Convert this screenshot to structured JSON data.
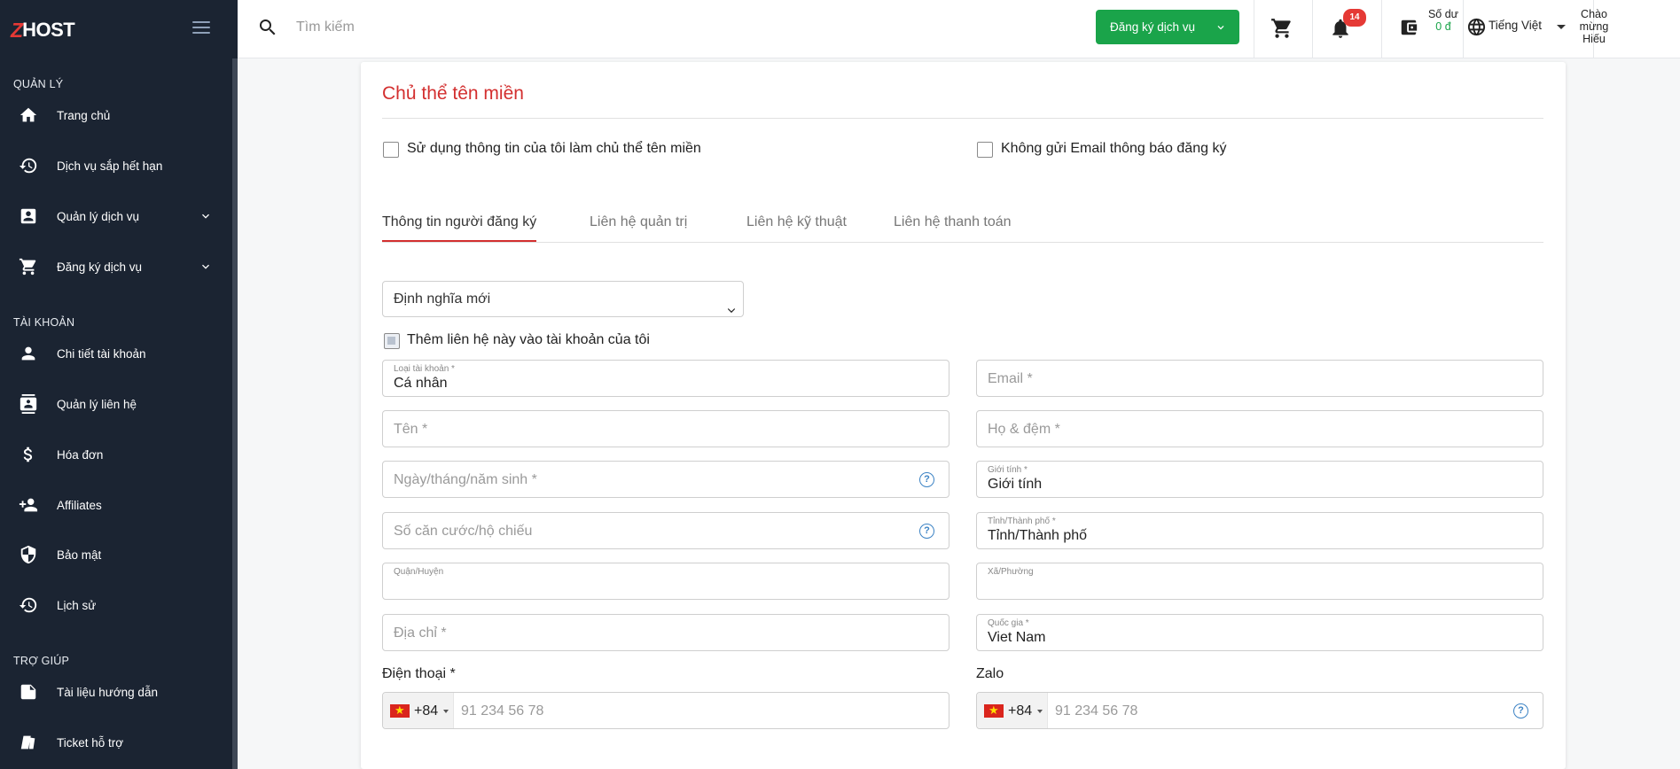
{
  "brand": {
    "logo_z": "Z",
    "logo_text": "HOST"
  },
  "sidebar": {
    "sections": [
      {
        "title": "QUẢN LÝ"
      },
      {
        "title": "TÀI KHOẢN"
      },
      {
        "title": "TRỢ GIÚP"
      }
    ],
    "items": [
      {
        "label": "Trang chủ",
        "icon": "home-icon"
      },
      {
        "label": "Dịch vụ sắp hết hạn",
        "icon": "history-icon"
      },
      {
        "label": "Quản lý dịch vụ",
        "icon": "account-box-icon",
        "expandable": true
      },
      {
        "label": "Đăng ký dịch vụ",
        "icon": "cart-icon",
        "expandable": true
      },
      {
        "label": "Chi tiết tài khoản",
        "icon": "person-icon"
      },
      {
        "label": "Quản lý liên hệ",
        "icon": "contacts-icon"
      },
      {
        "label": "Hóa đơn",
        "icon": "dollar-icon"
      },
      {
        "label": "Affiliates",
        "icon": "person-add-icon"
      },
      {
        "label": "Bảo mật",
        "icon": "shield-icon"
      },
      {
        "label": "Lịch sử",
        "icon": "history-icon"
      },
      {
        "label": "Tài liệu hướng dẫn",
        "icon": "document-icon"
      },
      {
        "label": "Ticket hỗ trợ",
        "icon": "ticket-icon"
      }
    ]
  },
  "topbar": {
    "search_placeholder": "Tìm kiếm",
    "register_button": "Đăng ký dịch vụ",
    "notification_count": "14",
    "balance_label": "Số dư",
    "balance_amount": "0 đ",
    "language": "Tiếng Việt",
    "welcome": "Chào mừng Hiếu"
  },
  "card": {
    "title": "Chủ thể tên miền",
    "use_my_info": "Sử dụng thông tin của tôi làm chủ thể tên miền",
    "no_email": "Không gửi Email thông báo đăng ký",
    "tabs": [
      {
        "label": "Thông tin người đăng ký",
        "active": true
      },
      {
        "label": "Liên hệ quản trị"
      },
      {
        "label": "Liên hệ kỹ thuật"
      },
      {
        "label": "Liên hệ thanh toán"
      }
    ],
    "contact_select": "Định nghĩa mới",
    "add_contact": "Thêm liên hệ này vào tài khoản của tôi",
    "fields": {
      "account_type": {
        "label": "Loại tài khoản *",
        "value": "Cá nhân"
      },
      "email": {
        "placeholder": "Email *"
      },
      "first_name": {
        "placeholder": "Tên *"
      },
      "last_name": {
        "placeholder": "Họ & đệm *"
      },
      "dob": {
        "placeholder": "Ngày/tháng/năm sinh *"
      },
      "gender": {
        "label": "Giới tính *",
        "value": "Giới tính"
      },
      "id_number": {
        "placeholder": "Số căn cước/hộ chiếu"
      },
      "province": {
        "label": "Tỉnh/Thành phố *",
        "value": "Tỉnh/Thành phố"
      },
      "district": {
        "label": "Quận/Huyện",
        "value": ""
      },
      "ward": {
        "label": "Xã/Phường",
        "value": ""
      },
      "address": {
        "placeholder": "Địa chỉ *"
      },
      "country": {
        "label": "Quốc gia *",
        "value": "Viet Nam"
      }
    },
    "phone": {
      "label": "Điện thoại *",
      "dial_code": "+84",
      "placeholder": "91 234 56 78"
    },
    "zalo": {
      "label": "Zalo",
      "dial_code": "+84",
      "placeholder": "91 234 56 78"
    },
    "help_glyph": "?"
  }
}
